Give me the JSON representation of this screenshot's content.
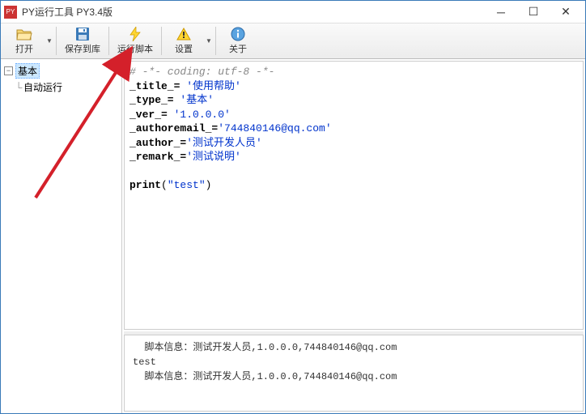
{
  "window": {
    "title": "PY运行工具 PY3.4版"
  },
  "toolbar": {
    "open": "打开",
    "save": "保存到库",
    "run": "运行脚本",
    "settings": "设置",
    "about": "关于"
  },
  "tree": {
    "root": "基本",
    "child1": "自动运行"
  },
  "code": {
    "l1": "# -*- coding: utf-8 -*-",
    "l2a": "_title_= ",
    "l2b": "'使用帮助'",
    "l3a": "_type_= ",
    "l3b": "'基本'",
    "l4a": "_ver_= ",
    "l4b": "'1.0.0.0'",
    "l5a": "_authoremail_=",
    "l5b": "'744840146@qq.com'",
    "l6a": "_author_=",
    "l6b": "'测试开发人员'",
    "l7a": "_remark_=",
    "l7b": "'测试说明'",
    "l9a": "print",
    "l9b": "(",
    "l9c": "\"test\"",
    "l9d": ")"
  },
  "output": {
    "line1": "  脚本信息：测试开发人员,1.0.0.0,744840146@qq.com",
    "line2": "test",
    "line3": "  脚本信息：测试开发人员,1.0.0.0,744840146@qq.com"
  }
}
